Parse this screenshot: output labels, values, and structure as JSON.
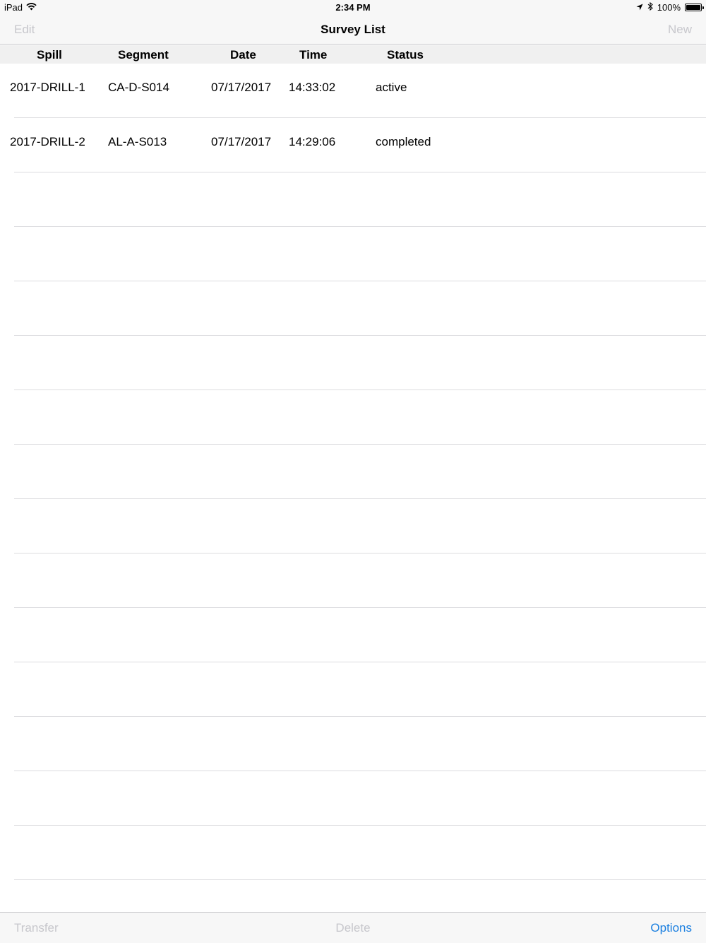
{
  "status_bar": {
    "device": "iPad",
    "time": "2:34 PM",
    "battery": "100%",
    "battery_level": 1.0,
    "icons": [
      "wifi-icon",
      "location-icon",
      "bluetooth-icon",
      "battery-icon"
    ]
  },
  "navbar": {
    "title": "Survey List",
    "left_button": "Edit",
    "right_button": "New"
  },
  "columns": [
    "Spill",
    "Segment",
    "Date",
    "Time",
    "Status"
  ],
  "rows": [
    {
      "spill": "2017-DRILL-1",
      "segment": "CA-D-S014",
      "date": "07/17/2017",
      "time": "14:33:02",
      "status": "active"
    },
    {
      "spill": "2017-DRILL-2",
      "segment": "AL-A-S013",
      "date": "07/17/2017",
      "time": "14:29:06",
      "status": "completed"
    },
    {
      "spill": "",
      "segment": "",
      "date": "",
      "time": "",
      "status": ""
    },
    {
      "spill": "",
      "segment": "",
      "date": "",
      "time": "",
      "status": ""
    },
    {
      "spill": "",
      "segment": "",
      "date": "",
      "time": "",
      "status": ""
    },
    {
      "spill": "",
      "segment": "",
      "date": "",
      "time": "",
      "status": ""
    },
    {
      "spill": "",
      "segment": "",
      "date": "",
      "time": "",
      "status": ""
    },
    {
      "spill": "",
      "segment": "",
      "date": "",
      "time": "",
      "status": ""
    },
    {
      "spill": "",
      "segment": "",
      "date": "",
      "time": "",
      "status": ""
    },
    {
      "spill": "",
      "segment": "",
      "date": "",
      "time": "",
      "status": ""
    },
    {
      "spill": "",
      "segment": "",
      "date": "",
      "time": "",
      "status": ""
    },
    {
      "spill": "",
      "segment": "",
      "date": "",
      "time": "",
      "status": ""
    },
    {
      "spill": "",
      "segment": "",
      "date": "",
      "time": "",
      "status": ""
    },
    {
      "spill": "",
      "segment": "",
      "date": "",
      "time": "",
      "status": ""
    },
    {
      "spill": "",
      "segment": "",
      "date": "",
      "time": "",
      "status": ""
    },
    {
      "spill": "",
      "segment": "",
      "date": "",
      "time": "",
      "status": ""
    }
  ],
  "toolbar": {
    "transfer": "Transfer",
    "delete": "Delete",
    "options": "Options"
  },
  "colors": {
    "accent": "#1a7fe0",
    "disabled": "#c7c7cc",
    "bar_background": "#f7f7f7",
    "separator": "#dcdcdf"
  }
}
